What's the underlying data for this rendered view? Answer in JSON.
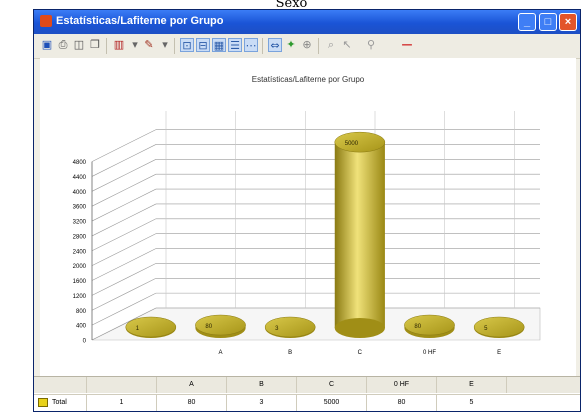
{
  "page_caption": "Sexo",
  "window": {
    "title": "Estatísticas/Lafiterne por Grupo",
    "controls": {
      "minimize": "_",
      "maximize": "□",
      "close": "×"
    }
  },
  "toolbar": {
    "icons": [
      "save-icon",
      "print-icon",
      "print-preview-icon",
      "copy-icon",
      "chart-type-icon",
      "palette-icon",
      "axis-view-icon",
      "legend-icon",
      "data-table-icon",
      "horizontal-grid-icon",
      "vertical-grid-icon",
      "rotate-icon",
      "chart-wizard-icon",
      "zoom-icon",
      "edit-icon",
      "pointer-icon",
      "close-data-icon"
    ],
    "accent": "#c9dcf6"
  },
  "chart_data": {
    "type": "bar",
    "style": "3d-cylinder",
    "title": "Estatísticas/Lafiterne por Grupo",
    "categories": [
      "",
      "A",
      "B",
      "C",
      "0 HF",
      "E"
    ],
    "values": [
      1,
      80,
      3,
      5000,
      80,
      5
    ],
    "data_labels": [
      "1",
      "80",
      "3",
      "5000",
      "80",
      "5"
    ],
    "y_ticks": [
      "0",
      "400",
      "800",
      "1200",
      "1600",
      "2000",
      "2400",
      "2800",
      "3200",
      "3600",
      "4000",
      "4400",
      "4800"
    ],
    "ylim": [
      0,
      5300
    ],
    "grid": true,
    "bar_color": "#c8b828"
  },
  "data_grid": {
    "headers": [
      "A",
      "B",
      "C",
      "0 HF",
      "E"
    ],
    "row_label": "Total",
    "values": [
      "1",
      "80",
      "3",
      "5000",
      "80",
      "5"
    ]
  }
}
